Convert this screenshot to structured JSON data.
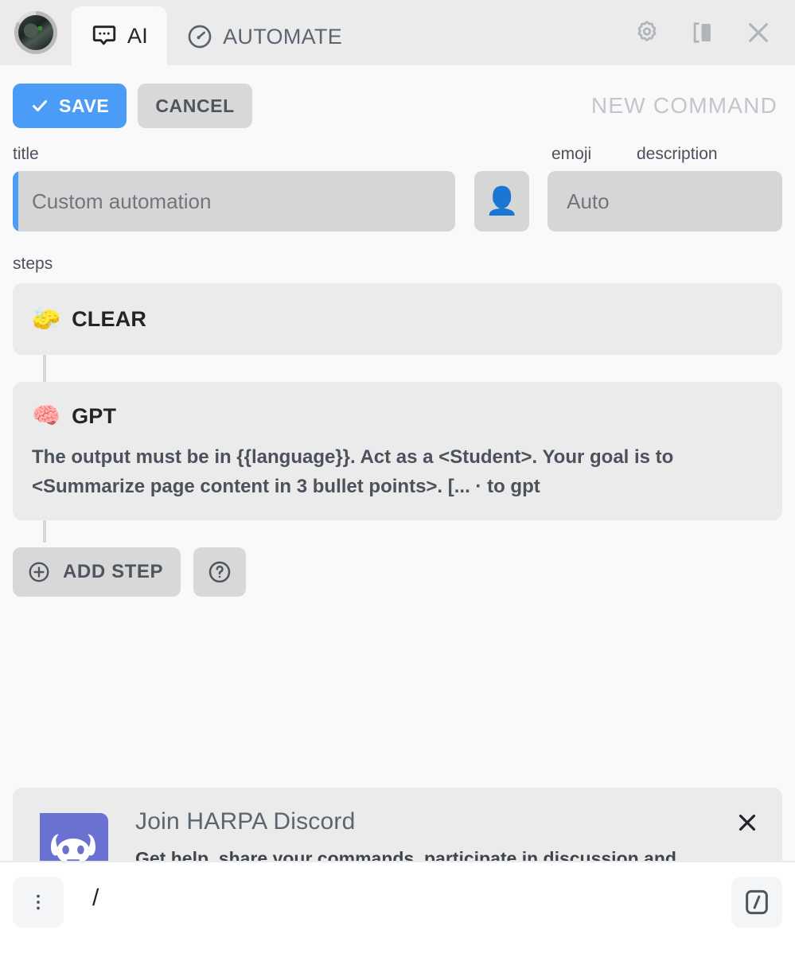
{
  "window": {
    "tabs": [
      {
        "id": "ai",
        "label": "AI",
        "icon": "chat-bubble-icon",
        "active": true
      },
      {
        "id": "automate",
        "label": "AUTOMATE",
        "icon": "gauge-icon",
        "active": false
      }
    ],
    "actions": [
      {
        "id": "settings",
        "icon": "gear-icon"
      },
      {
        "id": "panel",
        "icon": "sidebar-panel-icon"
      },
      {
        "id": "close",
        "icon": "close-icon"
      }
    ],
    "avatar": {
      "name": "user-avatar"
    }
  },
  "toolbar": {
    "save_label": "SAVE",
    "cancel_label": "CANCEL",
    "heading": "NEW COMMAND",
    "accent_color": "#4a9cf6"
  },
  "form": {
    "title": {
      "label": "title",
      "value": "",
      "placeholder": "Custom automation"
    },
    "emoji": {
      "label": "emoji",
      "value": "👤"
    },
    "description": {
      "label": "description",
      "value": "",
      "placeholder": "Auto"
    }
  },
  "steps": {
    "label": "steps",
    "items": [
      {
        "emoji": "🧽",
        "title": "CLEAR",
        "text": ""
      },
      {
        "emoji": "🧠",
        "title": "GPT",
        "text": "The output must be in {{language}}. Act as a <Student>. Your goal is to <Summarize page content in 3 bullet points>. [... · to gpt"
      }
    ],
    "add_step_label": "ADD STEP",
    "help_label": "?"
  },
  "banner": {
    "title": "Join HARPA Discord",
    "subtitle": "Get help, share your commands, participate in discussion and shape the future.",
    "brand_color": "#6a71d1",
    "close_label": "✕"
  },
  "composer": {
    "value": "/",
    "menu_icon": "kebab-menu-icon",
    "slash_icon": "slash-command-icon"
  }
}
